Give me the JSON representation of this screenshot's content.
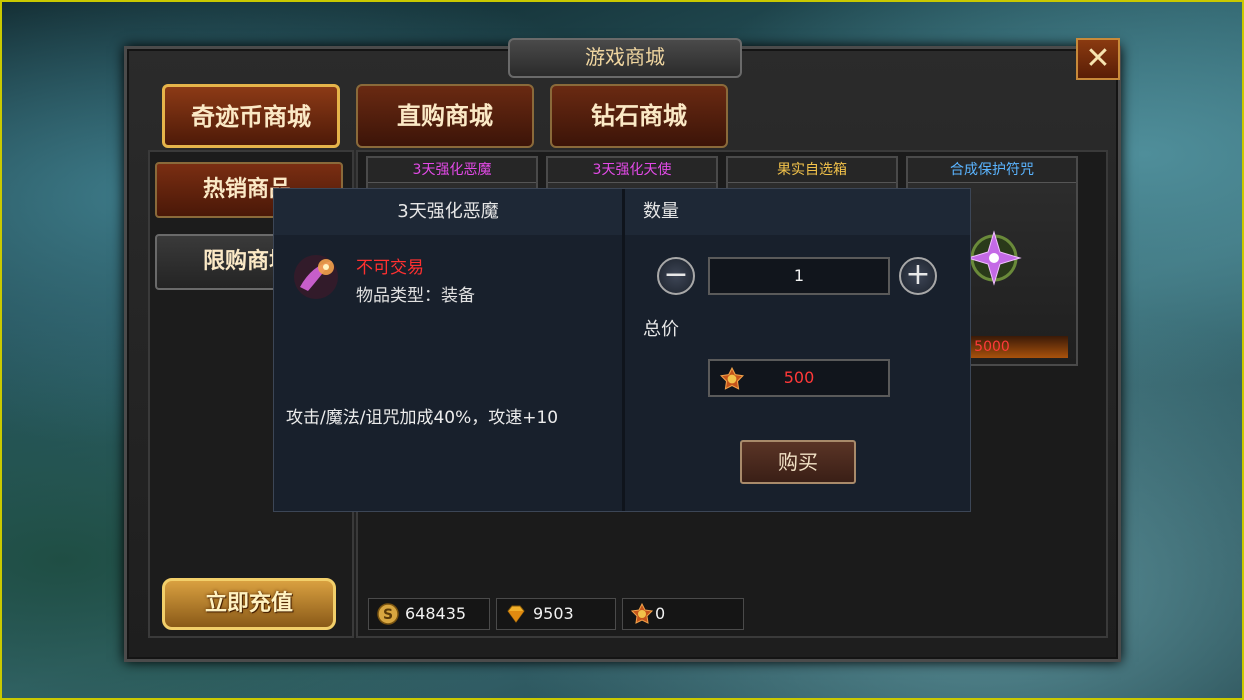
{
  "window": {
    "title": "游戏商城",
    "close_icon": "close-icon"
  },
  "tabs": [
    {
      "label": "奇迹币商城",
      "active": true
    },
    {
      "label": "直购商城",
      "active": false
    },
    {
      "label": "钻石商城",
      "active": false
    }
  ],
  "sidebar": {
    "items": [
      {
        "label": "热销商品",
        "active": true
      },
      {
        "label": "限购商城",
        "active": false
      }
    ],
    "recharge_label": "立即充值"
  },
  "items": [
    {
      "name": "3天强化恶魔",
      "name_color": "#e24ae6",
      "price": ""
    },
    {
      "name": "3天强化天使",
      "name_color": "#e24ae6",
      "price": ""
    },
    {
      "name": "果实自选箱",
      "name_color": "#f2c24a",
      "price": ""
    },
    {
      "name": "合成保护符咒",
      "name_color": "#5ab4ff",
      "price": "5000"
    }
  ],
  "currencies": [
    {
      "icon": "gold-coin-icon",
      "value": "648435"
    },
    {
      "icon": "diamond-icon",
      "value": "9503"
    },
    {
      "icon": "miracle-coin-icon",
      "value": "0"
    }
  ],
  "dialog": {
    "item_title": "3天强化恶魔",
    "trade_status": "不可交易",
    "item_type": "物品类型：装备",
    "description": "攻击/魔法/诅咒加成40%，攻速+10",
    "quantity_label": "数量",
    "quantity": "1",
    "total_label": "总价",
    "total_price": "500",
    "buy_label": "购买"
  },
  "colors": {
    "accent_gold": "#e6b44a",
    "price_red": "#ff3838",
    "no_trade_red": "#ff3030"
  }
}
